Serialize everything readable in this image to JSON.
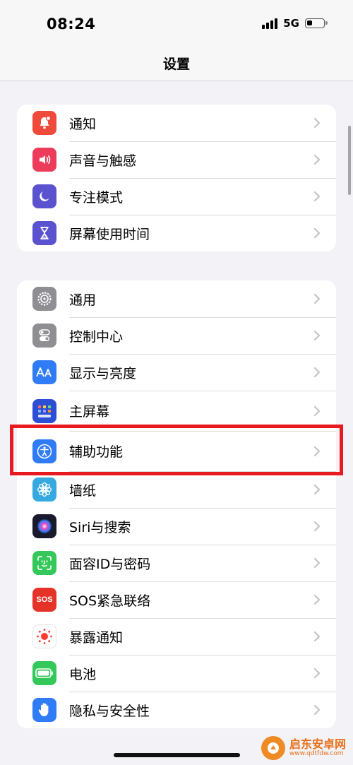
{
  "status_bar": {
    "time": "08:24",
    "network": "5G"
  },
  "nav": {
    "title": "设置"
  },
  "groups": [
    {
      "items": [
        {
          "label": "通知",
          "icon": "notifications-icon",
          "color": "#f04a3c"
        },
        {
          "label": "声音与触感",
          "icon": "sound-icon",
          "color": "#ec3b5b"
        },
        {
          "label": "专注模式",
          "icon": "focus-moon-icon",
          "color": "#5b52cf"
        },
        {
          "label": "屏幕使用时间",
          "icon": "screen-time-hourglass-icon",
          "color": "#5b52cf"
        }
      ]
    },
    {
      "items": [
        {
          "label": "通用",
          "icon": "gear-icon",
          "color": "#8e8e93"
        },
        {
          "label": "控制中心",
          "icon": "toggles-icon",
          "color": "#8e8e93"
        },
        {
          "label": "显示与亮度",
          "icon": "display-aa-icon",
          "color": "#2f7cf6"
        },
        {
          "label": "主屏幕",
          "icon": "home-screen-grid-icon",
          "color": "#2c4fd6"
        },
        {
          "label": "辅助功能",
          "icon": "accessibility-icon",
          "color": "#2f7cf6"
        },
        {
          "label": "墙纸",
          "icon": "wallpaper-flower-icon",
          "color": "#35a9e0"
        },
        {
          "label": "Siri与搜索",
          "icon": "siri-icon",
          "color": "#1a1a2e"
        },
        {
          "label": "面容ID与密码",
          "icon": "face-id-icon",
          "color": "#34c759"
        },
        {
          "label": "SOS紧急联络",
          "icon": "sos-icon",
          "color": "#e5332a",
          "icon_text": "SOS"
        },
        {
          "label": "暴露通知",
          "icon": "exposure-notification-icon",
          "color": "#ffffff"
        },
        {
          "label": "电池",
          "icon": "battery-icon",
          "color": "#34c759"
        },
        {
          "label": "隐私与安全性",
          "icon": "privacy-hand-icon",
          "color": "#2f7cf6"
        }
      ]
    }
  ],
  "highlight": {
    "color": "#e8191f"
  },
  "watermark": {
    "main": "启东安卓网",
    "sub": "www.qdtfdw.com"
  }
}
